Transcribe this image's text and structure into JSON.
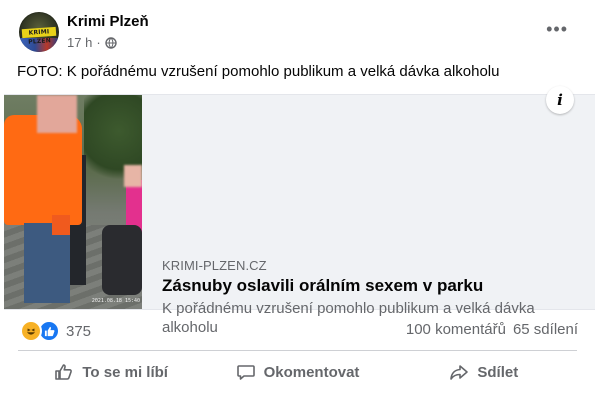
{
  "post": {
    "page_name": "Krimi Plzeň",
    "avatar_text": "KRIMI PLZEŇ",
    "time": "17 h",
    "separator": "·",
    "more_label": "•••",
    "text": "FOTO: K pořádnému vzrušení pomohlo publikum a velká dávka alkoholu"
  },
  "link": {
    "domain": "KRIMI-PLZEN.CZ",
    "title": "Zásnuby oslavili orálním sexem v parku",
    "description": "K pořádnému vzrušení pomohlo publikum a velká dávka alkoholu",
    "photo_timestamp": "2021.08.18 15:40",
    "info_label": "i"
  },
  "reactions": {
    "count": "375",
    "icons": [
      "haha-icon",
      "like-icon"
    ]
  },
  "stats": {
    "comments": "100 komentářů",
    "shares": "65 sdílení"
  },
  "actions": {
    "like": "To se mi líbí",
    "comment": "Okomentovat",
    "share": "Sdílet"
  },
  "colors": {
    "brand_blue": "#1877f2",
    "haha_yellow": "#f7b125",
    "secondary_text": "#65676b",
    "card_bg": "#f0f2f5"
  }
}
